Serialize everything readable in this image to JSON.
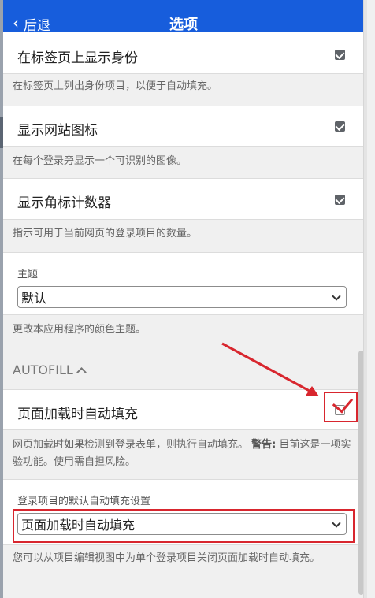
{
  "header": {
    "back_label": "后退",
    "title": "选项"
  },
  "options": [
    {
      "label": "在标签页上显示身份",
      "checked": true,
      "help": "在标签页上列出身份项目，以便于自动填充。"
    },
    {
      "label": "显示网站图标",
      "checked": true,
      "help": "在每个登录旁显示一个可识别的图像。"
    },
    {
      "label": "显示角标计数器",
      "checked": true,
      "help": "指示可用于当前网页的登录项目的数量。"
    }
  ],
  "theme": {
    "label": "主题",
    "selected": "默认",
    "help": "更改本应用程序的颜色主题。"
  },
  "autofill": {
    "section_title": "AUTOFILL",
    "option_label": "页面加载时自动填充",
    "checked": false,
    "help_text": "网页加载时如果检测到登录表单，则执行自动填充。",
    "warning_label": "警告:",
    "warning_text": "目前这是一项实验功能。使用需自担风险。",
    "default_label": "登录项目的默认自动填充设置",
    "default_selected": "页面加载时自动填充",
    "default_help": "您可以从项目编辑视图中为单个登录项目关闭页面加载时自动填充。"
  },
  "colors": {
    "header_bg": "#175ddc",
    "annotation_red": "#d8262e"
  }
}
